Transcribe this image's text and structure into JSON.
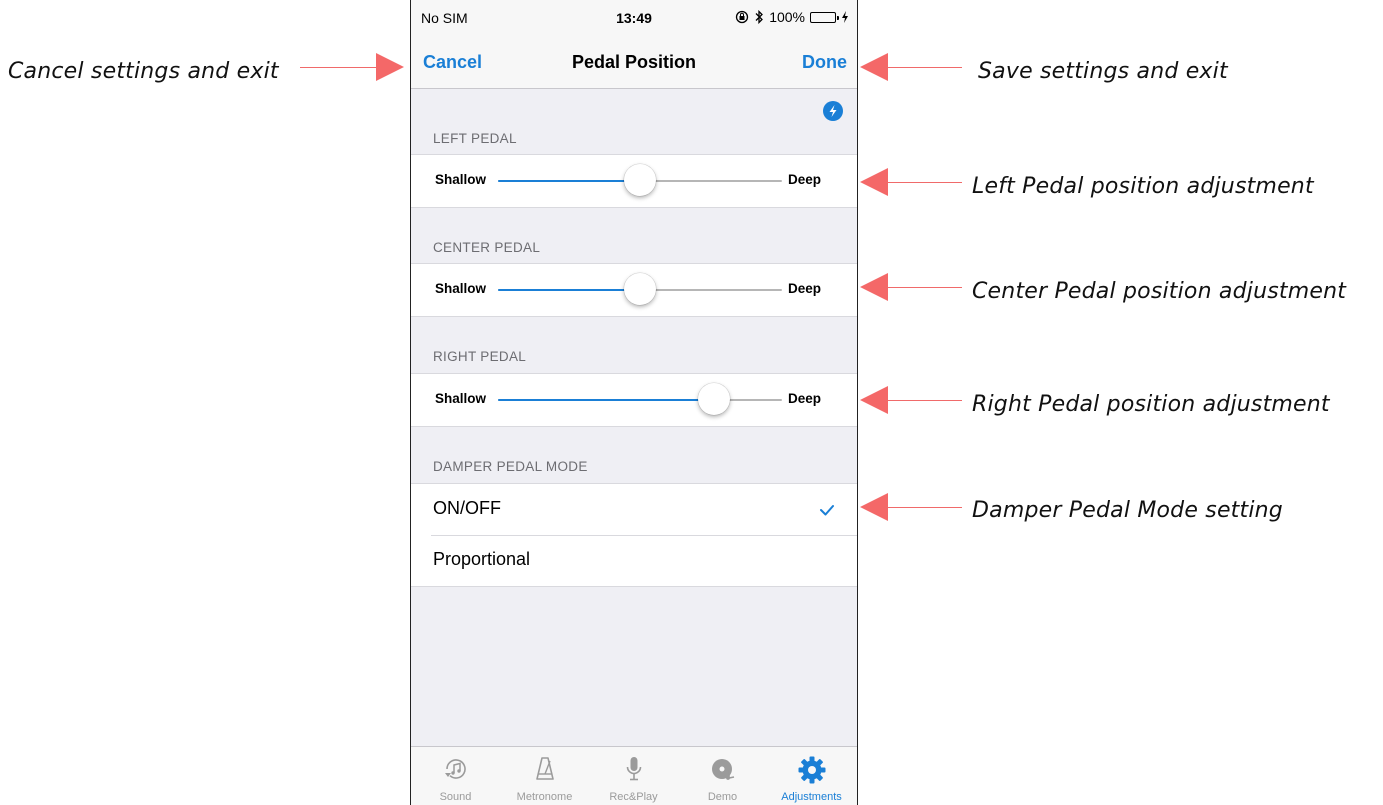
{
  "annotations": {
    "cancel": "Cancel settings and exit",
    "done": "Save settings and exit",
    "left_pedal": "Left Pedal position adjustment",
    "center_pedal": "Center Pedal position adjustment",
    "right_pedal": "Right Pedal position adjustment",
    "damper_mode": "Damper Pedal Mode setting",
    "arrow_color": "#f46868"
  },
  "status_bar": {
    "carrier": "No SIM",
    "time": "13:49",
    "battery": "100%"
  },
  "nav": {
    "cancel_label": "Cancel",
    "title": "Pedal Position",
    "done_label": "Done",
    "accent_color": "#1a7fd6"
  },
  "bluetooth_badge_icon": "bluetooth-lightning-icon",
  "pedals": [
    {
      "header": "LEFT PEDAL",
      "min_label": "Shallow",
      "max_label": "Deep",
      "value": 0.5
    },
    {
      "header": "CENTER PEDAL",
      "min_label": "Shallow",
      "max_label": "Deep",
      "value": 0.5
    },
    {
      "header": "RIGHT PEDAL",
      "min_label": "Shallow",
      "max_label": "Deep",
      "value": 0.76
    }
  ],
  "damper": {
    "header": "DAMPER PEDAL MODE",
    "options": [
      {
        "label": "ON/OFF",
        "selected": true
      },
      {
        "label": "Proportional",
        "selected": false
      }
    ]
  },
  "tabs": [
    {
      "label": "Sound",
      "icon": "sound-icon",
      "active": false
    },
    {
      "label": "Metronome",
      "icon": "metronome-icon",
      "active": false
    },
    {
      "label": "Rec&Play",
      "icon": "microphone-icon",
      "active": false
    },
    {
      "label": "Demo",
      "icon": "demo-disc-icon",
      "active": false
    },
    {
      "label": "Adjustments",
      "icon": "gear-icon",
      "active": true
    }
  ]
}
